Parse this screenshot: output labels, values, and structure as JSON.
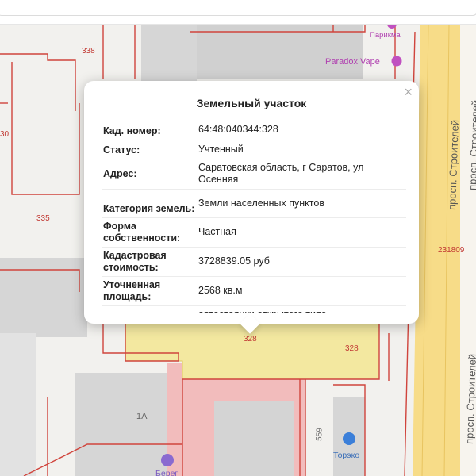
{
  "popup": {
    "title": "Земельный участок",
    "close_label": "×",
    "rows": [
      {
        "label": "Кад. номер:",
        "value": "64:48:040344:328"
      },
      {
        "label": "Статус:",
        "value": "Учтенный"
      },
      {
        "label": "Адрес:",
        "value": "Саратовская область, г Саратов, ул Осенняя"
      },
      {
        "label": "Категория земель:",
        "value": "Земли населенных пунктов"
      },
      {
        "label": "Форма собственности:",
        "value": "Частная"
      },
      {
        "label": "Кадастровая стоимость:",
        "value": "3728839.05 руб"
      },
      {
        "label": "Уточненная площадь:",
        "value": "2568 кв.м"
      },
      {
        "label": "",
        "value": "автостоянки открытого типа"
      }
    ]
  },
  "map": {
    "parcel_labels": [
      "338",
      "30",
      "335",
      "328",
      "328",
      "231809",
      "1А",
      "559"
    ],
    "street_labels": [
      "просп. Строителей",
      "просп. Строителей"
    ],
    "poi": [
      {
        "name": "Paradox Vape",
        "icon": "shopping-pin-icon",
        "color": "#c050c0"
      },
      {
        "name": "Парикма",
        "icon": "shopping-pin-icon",
        "color": "#c050c0"
      },
      {
        "name": "Торэко",
        "icon": "car-pin-icon",
        "color": "#3b7fd9"
      },
      {
        "name": "Берег",
        "icon": "shopping-pin-icon",
        "color": "#8a6ad0"
      }
    ],
    "colors": {
      "boundary": "#d0443c",
      "highlight": "#f3e8a0",
      "road": "#f5d77a",
      "building": "#d7d7d7",
      "pink_building": "#f2b6b6"
    }
  }
}
